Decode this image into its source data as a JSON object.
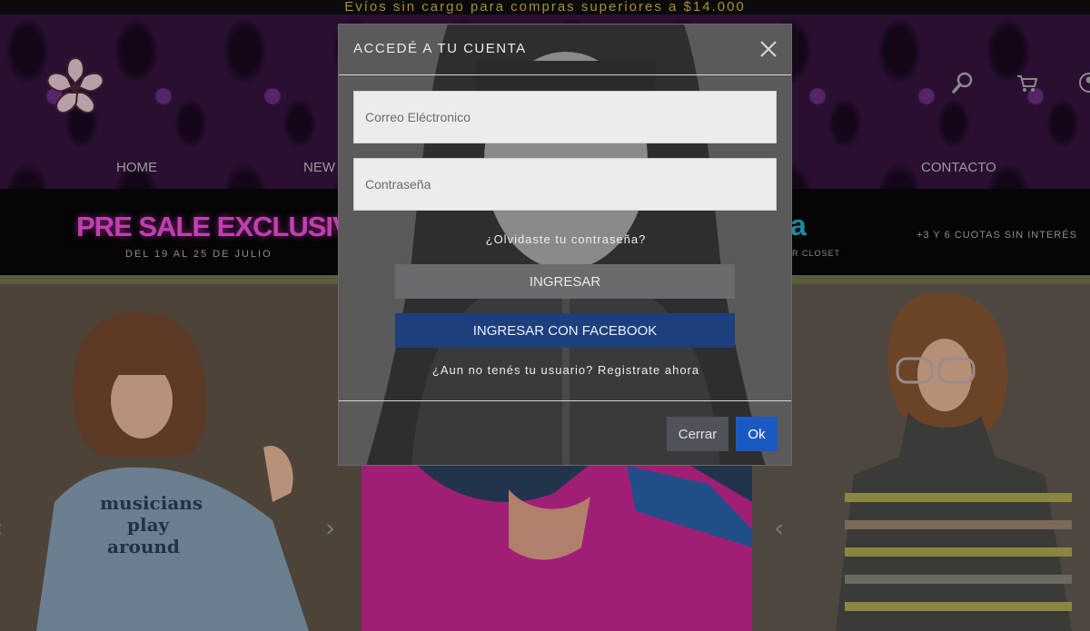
{
  "topbar": {
    "text": "Evíos sin cargo para compras superiores a $14.000"
  },
  "header": {
    "logo_icon": "cherry-blossom-logo",
    "search_icon": "search-icon",
    "cart_icon": "cart-icon",
    "user_icon": "user-icon"
  },
  "nav": {
    "items": [
      {
        "label": "HOME"
      },
      {
        "label": "NEW"
      },
      {
        "label": "CONTACTO"
      }
    ]
  },
  "promo": {
    "presale": "PRE SALE EXCLUSIVO",
    "dates": "DEL 19 AL 25 DE JULIO",
    "cyan_fragment": "a",
    "closet_fragment": "R CLOSET",
    "cuotas": "+3 Y 6 CUOTAS SIN INTERÉS"
  },
  "hero": {
    "tee_text_1": "musicians",
    "tee_text_2": "play",
    "tee_text_3": "around",
    "prev_arrow": "‹",
    "next_arrow": "›"
  },
  "modal": {
    "title": "ACCEDÉ A TU CUENTA",
    "email_placeholder": "Correo Eléctronico",
    "password_placeholder": "Contraseña",
    "forgot": "¿Olvidaste tu contraseña?",
    "login_button": "INGRESAR",
    "facebook_button": "INGRESAR CON FACEBOOK",
    "register": "¿Aun no tenés tu usuario? Registrate ahora",
    "close_button": "Cerrar",
    "ok_button": "Ok"
  },
  "colors": {
    "accent_blue": "#1b59c2",
    "facebook_blue": "#1d3f7e",
    "presale_pink": "#c23fb0",
    "topbar_gold": "#a89030"
  }
}
